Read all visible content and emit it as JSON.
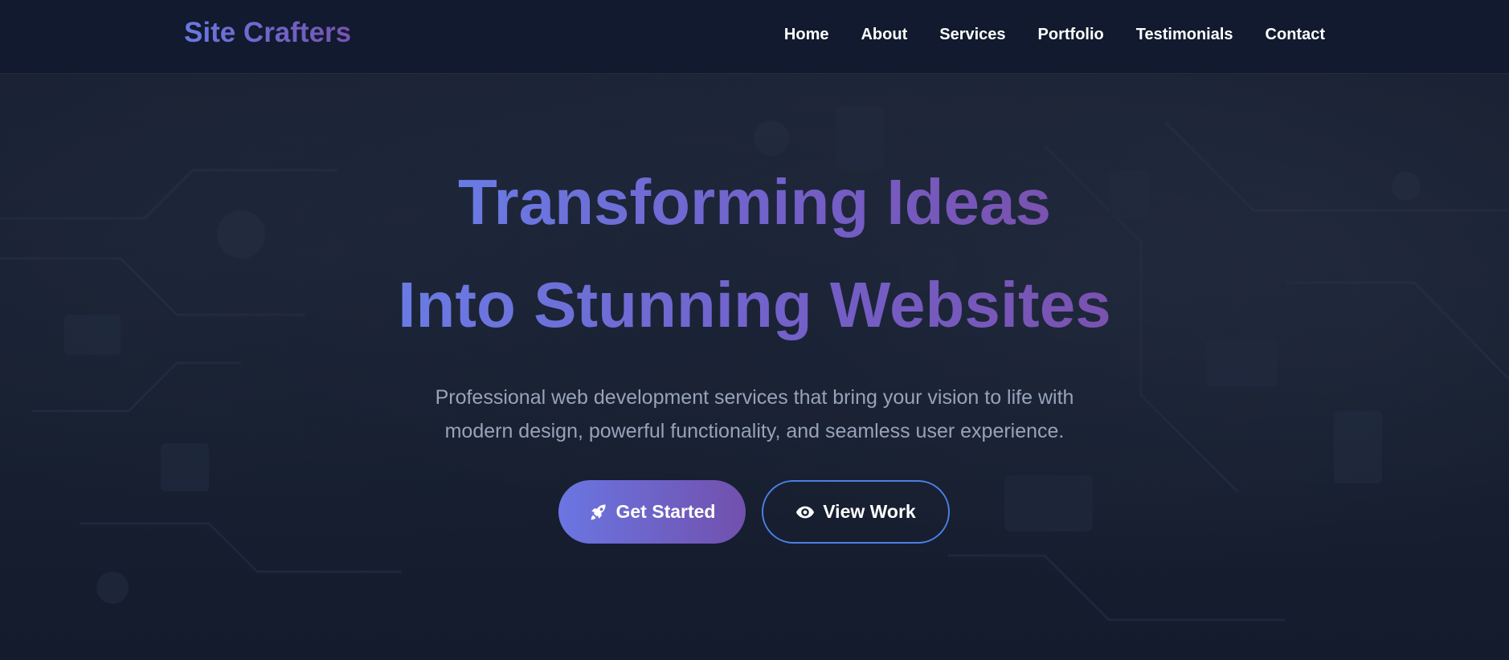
{
  "navbar": {
    "brand": "Site Crafters",
    "links": [
      "Home",
      "About",
      "Services",
      "Portfolio",
      "Testimonials",
      "Contact"
    ]
  },
  "hero": {
    "title_line1": "Transforming Ideas",
    "title_line2": "Into Stunning Websites",
    "subtitle_line1": "Professional web development services that bring your vision to life with",
    "subtitle_line2": "modern design, powerful functionality, and seamless user experience.",
    "primary_button": {
      "label": "Get Started",
      "icon": "rocket-icon"
    },
    "secondary_button": {
      "label": "View Work",
      "icon": "eye-icon"
    }
  },
  "colors": {
    "background": "#121a2c",
    "navbar": "#111a2e",
    "gradient_start": "#6a78e2",
    "gradient_end": "#7653b0",
    "subtitle": "#98a3b8",
    "outline_button_border": "#4b7fe6"
  }
}
